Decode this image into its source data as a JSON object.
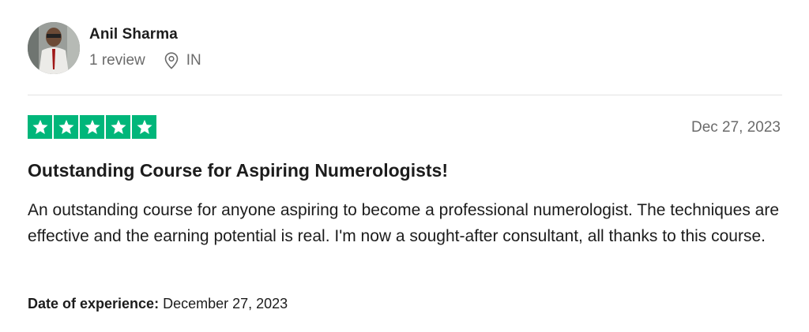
{
  "consumer": {
    "name": "Anil Sharma",
    "review_count": "1 review",
    "country": "IN"
  },
  "review": {
    "rating": 5,
    "rating_color": "#00b67a",
    "date": "Dec 27, 2023",
    "title": "Outstanding Course for Aspiring Numerologists!",
    "body": "An outstanding course for anyone aspiring to become a professional numerologist. The techniques are effective and the earning potential is real. I'm now a sought-after consultant, all thanks to this course.",
    "experience_label": "Date of experience:",
    "experience_date": "December 27, 2023"
  },
  "icons": {
    "location": "location-pin-icon",
    "star": "star-icon"
  }
}
